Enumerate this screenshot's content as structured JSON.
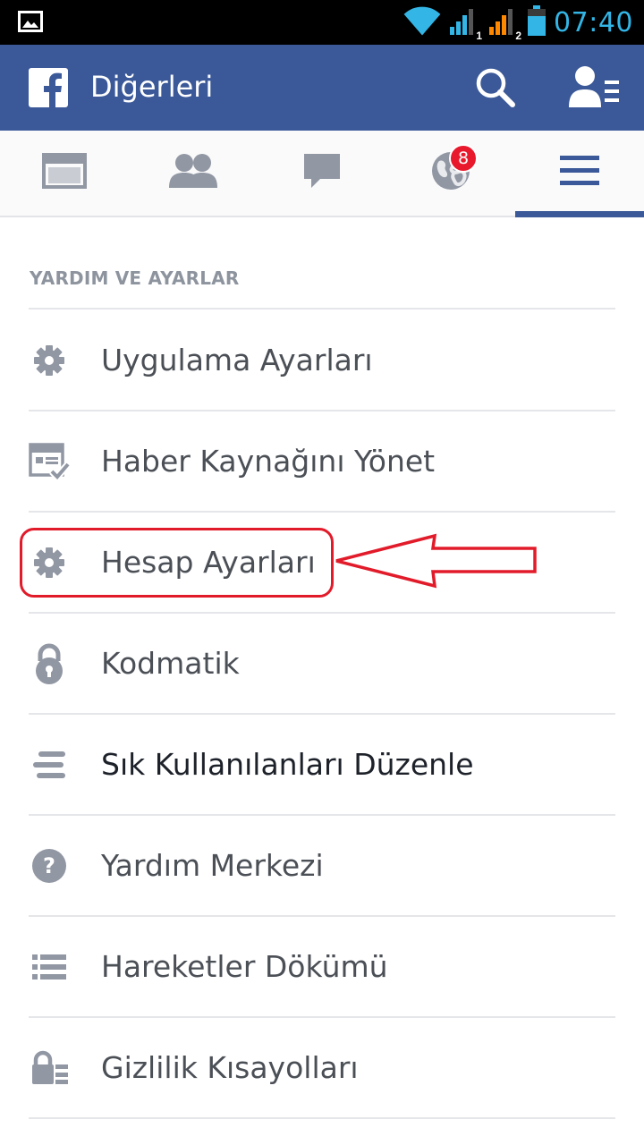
{
  "status_bar": {
    "time": "07:40",
    "sim1": "1",
    "sim2": "2",
    "icons": [
      "image-notification-icon",
      "wifi-icon",
      "signal-sim1-icon",
      "signal-sim2-icon",
      "battery-icon"
    ]
  },
  "header": {
    "title": "Diğerleri",
    "background": "#3b5998"
  },
  "tabs": {
    "items": [
      "news-feed-icon",
      "friend-requests-icon",
      "messages-icon",
      "notifications-icon",
      "more-menu-icon"
    ],
    "notifications_badge": "8",
    "active_index": 4
  },
  "section": {
    "title": "YARDIM VE AYARLAR"
  },
  "menu": {
    "items": [
      {
        "label": "Uygulama Ayarları",
        "icon": "gear-icon"
      },
      {
        "label": "Haber Kaynağını Yönet",
        "icon": "news-feed-manage-icon"
      },
      {
        "label": "Hesap Ayarları",
        "icon": "gear-icon"
      },
      {
        "label": "Kodmatik",
        "icon": "lock-icon"
      },
      {
        "label": "Sık Kullanılanları Düzenle",
        "icon": "edit-list-icon"
      },
      {
        "label": "Yardım Merkezi",
        "icon": "help-icon"
      },
      {
        "label": "Hareketler Dökümü",
        "icon": "activity-log-icon"
      },
      {
        "label": "Gizlilik Kısayolları",
        "icon": "privacy-shortcut-icon"
      }
    ]
  },
  "annotation": {
    "color": "#e21b2a",
    "highlighted_item": "Hesap Ayarları"
  }
}
